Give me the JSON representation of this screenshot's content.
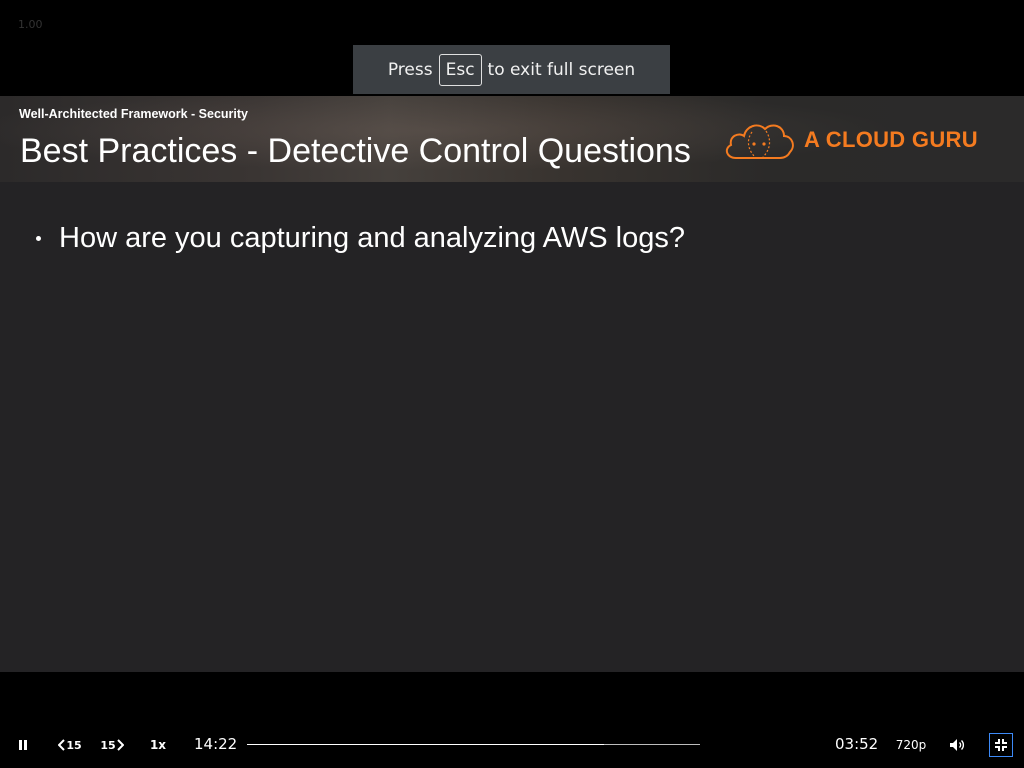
{
  "player": {
    "rate_readout": "1.00",
    "fullscreen_notice": {
      "before": "Press",
      "key": "Esc",
      "after": "to exit full screen"
    }
  },
  "slide": {
    "kicker": "Well-Architected Framework - Security",
    "title": "Best Practices - Detective Control Questions",
    "logo_text": "A CLOUD GURU",
    "bullets": [
      "How are you capturing and analyzing AWS logs?"
    ]
  },
  "controls": {
    "elapsed": "14:22",
    "remaining": "03:52",
    "progress": 0.787,
    "rewind_label": "15",
    "forward_label": "15",
    "speed_label": "1x",
    "quality_label": "720p",
    "icons": [
      "pause-icon",
      "rewind-15-icon",
      "forward-15-icon",
      "volume-icon",
      "exit-fullscreen-icon"
    ]
  },
  "colors": {
    "brand_orange": "#f47b20",
    "slide_background": "#242325",
    "notice_background": "#3b3f43",
    "focus_outline": "#3d8af7"
  }
}
